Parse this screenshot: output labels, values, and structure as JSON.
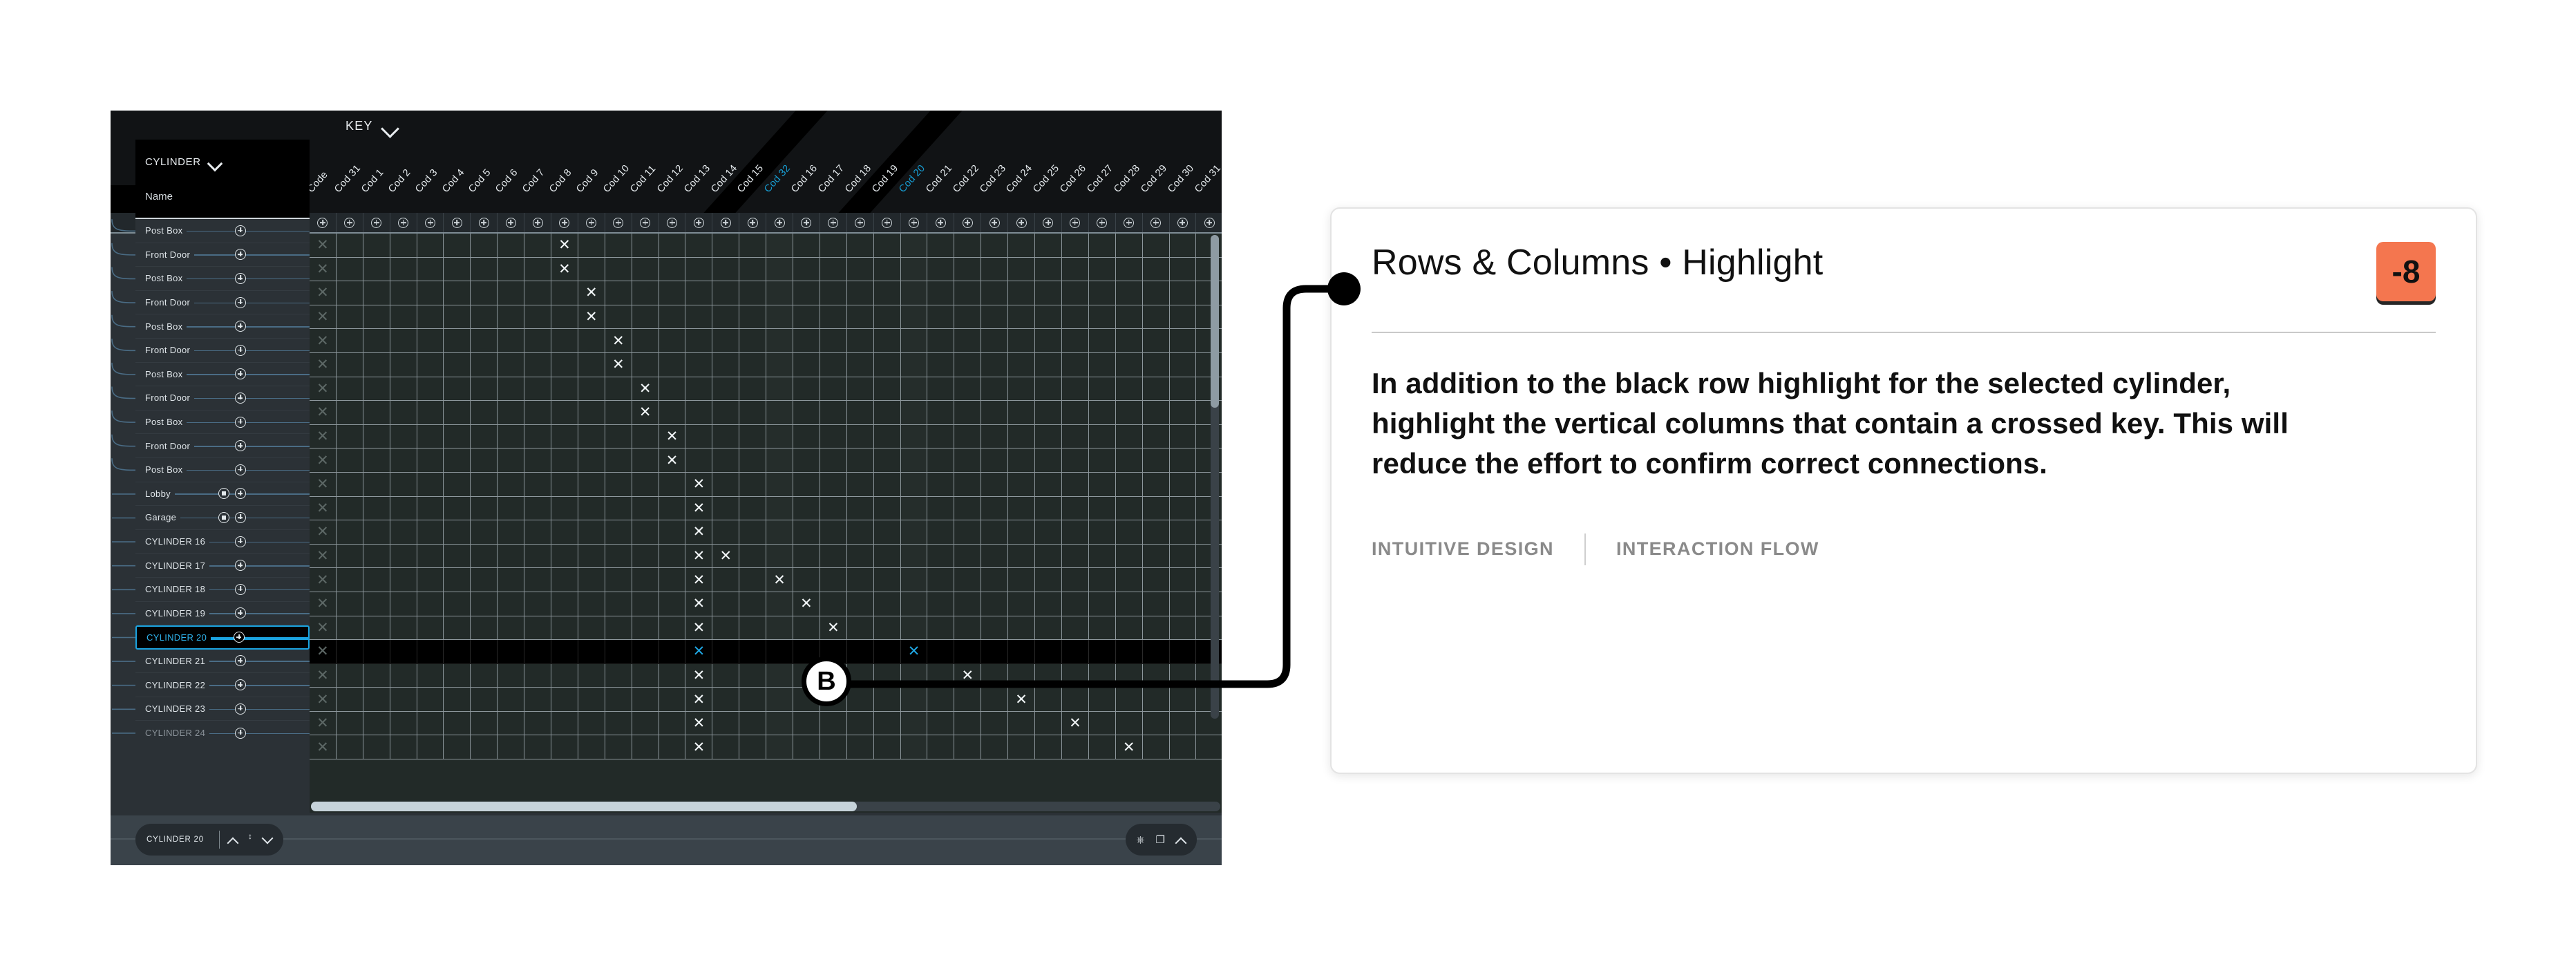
{
  "app": {
    "key_header": {
      "label": "KEY",
      "icon": "chevron-down-icon"
    },
    "cylinder_panel": {
      "title": "CYLINDER",
      "icon": "chevron-down-icon",
      "name_label": "Name"
    },
    "row_labels": [
      "Post Box",
      "Front Door",
      "Post Box",
      "Front Door",
      "Post Box",
      "Front Door",
      "Post Box",
      "Front Door",
      "Post Box",
      "Front Door",
      "Post Box",
      "Lobby",
      "Garage",
      "CYLINDER 16",
      "CYLINDER 17",
      "CYLINDER 18",
      "CYLINDER 19",
      "CYLINDER 20",
      "CYLINDER 21",
      "CYLINDER 22",
      "CYLINDER 23",
      "CYLINDER 24"
    ],
    "selected_row": "CYLINDER 20",
    "column_headers": [
      "Code",
      "Cod 31",
      "Cod 1",
      "Cod 2",
      "Cod 3",
      "Cod 4",
      "Cod 5",
      "Cod 6",
      "Cod 7",
      "Cod 8",
      "Cod 9",
      "Cod 10",
      "Cod 11",
      "Cod 12",
      "Cod 13",
      "Cod 14",
      "Cod 15",
      "Cod 32",
      "Cod 16",
      "Cod 17",
      "Cod 18",
      "Cod 19",
      "Cod 20",
      "Cod 21",
      "Cod 22",
      "Cod 23",
      "Cod 24",
      "Cod 25",
      "Cod 26",
      "Cod 27",
      "Cod 28",
      "Cod 29",
      "Cod 30",
      "Cod 31"
    ],
    "highlighted_columns": [
      "Cod 32",
      "Cod 20"
    ],
    "highlighted_column_color": "#179ed4",
    "status_bar": {
      "cylinder_label": "CYLINDER 20",
      "nav_up_icon": "caret-up-icon",
      "nav_resize_icon": "expand-vertical-icon",
      "nav_down_icon": "caret-down-icon",
      "delete_icon": "trash-icon",
      "export_icon": "external-link-icon",
      "collapse_icon": "caret-up-icon"
    },
    "selection_color": "#1ba3e0",
    "grid_bg": "#222a28",
    "panel_bg": "#2b3136"
  },
  "callout": {
    "marker": "B"
  },
  "card": {
    "title": "Rows & Columns • Highlight",
    "badge": "-8",
    "badge_color": "#f4764f",
    "body": "In addition to the black row highlight for the selected cylinder, highlight the vertical columns that contain a crossed key. This will reduce the effort to confirm correct connections.",
    "tags": [
      "INTUITIVE DESIGN",
      "INTERACTION FLOW"
    ]
  },
  "grid_marks": {
    "code_column_rows": [
      0,
      1,
      2,
      3,
      4,
      5,
      6,
      7,
      8,
      9,
      10,
      11,
      12,
      13,
      14,
      15,
      16,
      17,
      18,
      19,
      20,
      21
    ],
    "pattern": [
      {
        "row": 0,
        "cols": [
          9
        ]
      },
      {
        "row": 1,
        "cols": [
          9
        ]
      },
      {
        "row": 2,
        "cols": [
          10
        ]
      },
      {
        "row": 3,
        "cols": [
          10
        ]
      },
      {
        "row": 4,
        "cols": [
          11
        ]
      },
      {
        "row": 5,
        "cols": [
          11
        ]
      },
      {
        "row": 6,
        "cols": [
          12
        ]
      },
      {
        "row": 7,
        "cols": [
          12
        ]
      },
      {
        "row": 8,
        "cols": [
          13
        ]
      },
      {
        "row": 9,
        "cols": [
          13
        ]
      },
      {
        "row": 10,
        "cols": [
          14
        ]
      },
      {
        "row": 11,
        "cols": [
          14
        ]
      },
      {
        "row": 12,
        "cols": [
          14
        ]
      },
      {
        "row": 13,
        "cols": [
          14,
          15
        ]
      },
      {
        "row": 14,
        "cols": [
          14,
          17
        ]
      },
      {
        "row": 15,
        "cols": [
          14,
          18
        ]
      },
      {
        "row": 16,
        "cols": [
          14,
          19
        ]
      },
      {
        "row": 17,
        "cols": [
          14,
          22
        ]
      },
      {
        "row": 18,
        "cols": [
          14,
          24
        ]
      },
      {
        "row": 19,
        "cols": [
          14,
          26
        ]
      },
      {
        "row": 20,
        "cols": [
          14,
          28
        ]
      },
      {
        "row": 21,
        "cols": [
          14,
          30
        ]
      }
    ]
  }
}
